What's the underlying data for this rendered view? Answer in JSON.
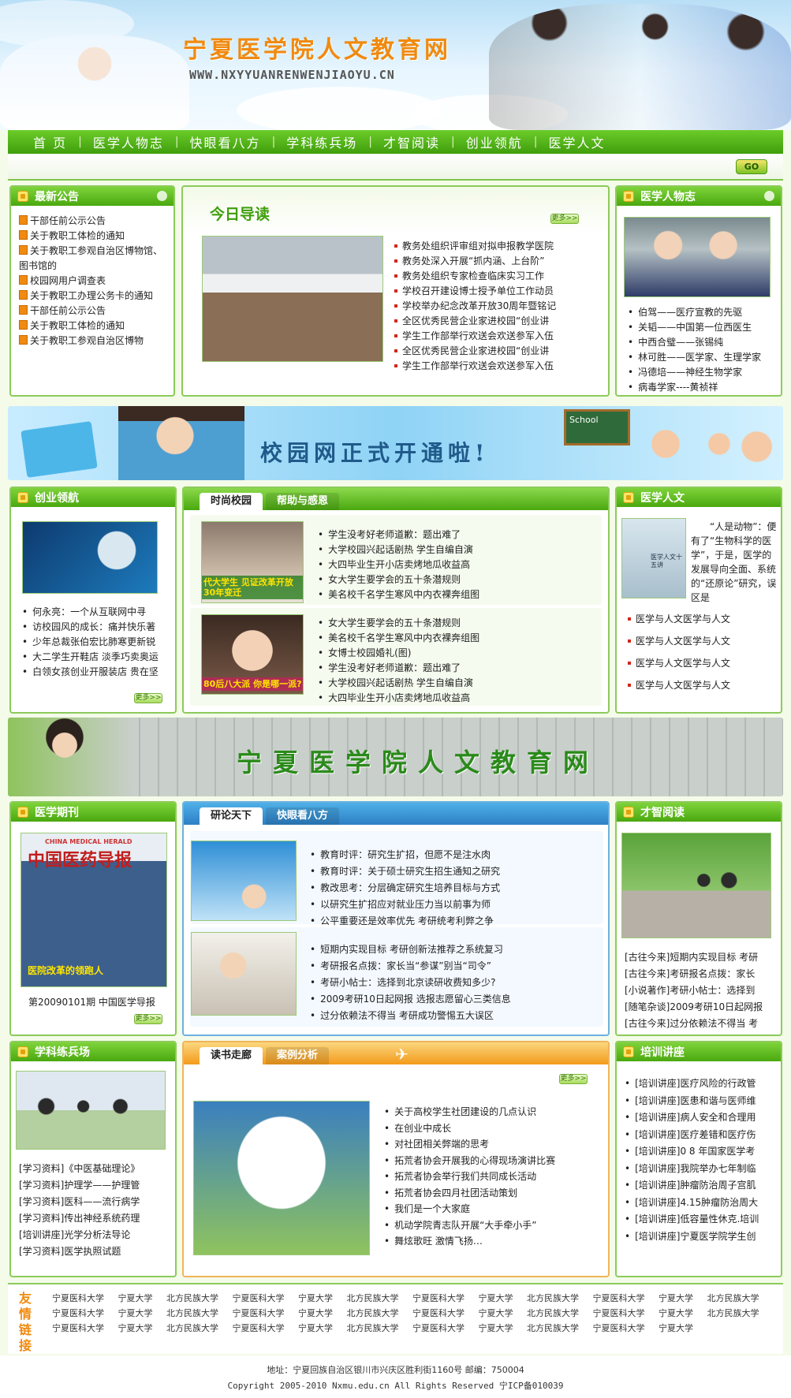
{
  "header": {
    "title": "宁夏医学院人文教育网",
    "url": "WWW.NXYYUANRENWENJIAOYU.CN"
  },
  "nav": [
    "首 页",
    "医学人物志",
    "快眼看八方",
    "学科练兵场",
    "才智阅读",
    "创业领航",
    "医学人文"
  ],
  "search": {
    "go_label": "GO"
  },
  "notice": {
    "title": "最新公告",
    "items": [
      "干部任前公示公告",
      "关于教职工体检的通知",
      "关于教职工参观自治区博物馆、图书馆的",
      "校园网用户调查表",
      "关于教职工办理公务卡的通知",
      "干部任前公示公告",
      "关于教职工体检的通知",
      "关于教职工参观自治区博物"
    ]
  },
  "today": {
    "title": "今日导读",
    "more": "更多>>",
    "items": [
      "教务处组织评审组对拟申报教学医院",
      "教务处深入开展“抓内涵、上台阶”",
      "教务处组织专家检查临床实习工作",
      "学校召开建设博士授予单位工作动员",
      "学校举办纪念改革开放30周年暨铭记",
      "全区优秀民营企业家进校园“创业讲",
      "学生工作部举行欢送会欢送参军入伍",
      "全区优秀民营企业家进校园“创业讲",
      "学生工作部举行欢送会欢送参军入伍"
    ]
  },
  "figures": {
    "title": "医学人物志",
    "items": [
      "伯驾——医疗宣教的先驱",
      "关韬——中国第一位西医生",
      "中西合璧——张锡纯",
      "林可胜——医学家、生理学家",
      "冯德培——神经生物学家",
      "病毒学家----黄祯祥"
    ]
  },
  "banner1": {
    "text": "校园网正式开通啦!",
    "school": "School"
  },
  "startup": {
    "title": "创业领航",
    "more": "更多>>",
    "items": [
      "何永亮：一个从互联网中寻",
      "访校园风的成长：痛并快乐著",
      "少年总裁张伯宏比肺寒更新锐",
      "大二学生开鞋店 淡季巧卖奥运",
      "白领女孩创业开服装店 贵在坚"
    ]
  },
  "campus": {
    "tabs": [
      "时尚校园",
      "帮助与感恩"
    ],
    "img1_text": "代大学生 见证改革开放30年变迁",
    "img2_text": "80后八大派 你是哪一派?",
    "list1": [
      "学生没考好老师道歉：题出难了",
      "大学校园兴起话剧热 学生自编自演",
      "大四毕业生开小店卖烤地瓜收益高",
      "女大学生要学会的五十条潜规则",
      "美名校千名学生寒风中内衣裸奔组图"
    ],
    "list2": [
      "女大学生要学会的五十条潜规则",
      "美名校千名学生寒风中内衣裸奔组图",
      "女博士校园婚礼(图)",
      "学生没考好老师道歉：题出难了",
      "大学校园兴起话剧热 学生自编自演",
      "大四毕业生开小店卖烤地瓜收益高"
    ]
  },
  "humanities": {
    "title": "医学人文",
    "book_title": "医学人文十五讲",
    "intro": "“人是动物”：便有了“生物科学的医学”，于是，医学的发展导向全面、系统的“还原论”研究，误区是",
    "items": [
      "医学与人文医学与人文",
      "医学与人文医学与人文",
      "医学与人文医学与人文",
      "医学与人文医学与人文"
    ]
  },
  "banner2": {
    "text": "宁夏医学院人文教育网"
  },
  "journal": {
    "title": "医学期刊",
    "cover_title": "中国医药导报",
    "cover_en": "CHINA MEDICAL HERALD",
    "cover_caption": "医院改革的领跑人",
    "issue": "第20090101期 中国医学导报",
    "more": "更多>>"
  },
  "discuss": {
    "tabs": [
      "研论天下",
      "快眼看八方"
    ],
    "list1": [
      "教育时评：研究生扩招，但愿不是注水肉",
      "教育时评：关于硕士研究生招生通知之研究",
      "教改思考：分层确定研究生培养目标与方式",
      "以研究生扩招应对就业压力当以前事为师",
      "公平重要还是效率优先 考研统考利弊之争"
    ],
    "list2": [
      "短期内实现目标 考研创新法推荐之系统复习",
      "考研报名点拨：家长当“参谋”别当“司令”",
      "考研小帖士：选择到北京读研收费知多少?",
      "2009考研10日起网报 选报志愿留心三类信息",
      "过分依赖法不得当 考研成功警惕五大误区"
    ]
  },
  "reading": {
    "title": "才智阅读",
    "items": [
      "[古往今来]短期内实现目标 考研",
      "[古往今来]考研报名点拨：家长",
      "[小说著作]考研小帖士：选择到",
      "[随笔杂谈]2009考研10日起网报",
      "[古往今来]过分依赖法不得当 考"
    ]
  },
  "drill": {
    "title": "学科练兵场",
    "items": [
      "[学习资料]《中医基础理论》",
      "[学习资料]护理学——护理管",
      "[学习资料]医科——流行病学",
      "[学习资料]传出神经系统药理",
      "[培训讲座]光学分析法导论",
      "[学习资料]医学执照试题"
    ]
  },
  "books": {
    "tabs": [
      "读书走廊",
      "案例分析"
    ],
    "more": "更多>>",
    "items": [
      "关于高校学生社团建设的几点认识",
      "在创业中成长",
      "对社团相关弊端的思考",
      "拓荒者协会开展我的心得现场演讲比赛",
      "拓荒者协会举行我们共同成长活动",
      "拓荒者协会四月社团活动策划",
      "我们是一个大家庭",
      "机动学院青志队开展“大手牵小手”",
      "舞炫歌旺 激情飞扬…"
    ]
  },
  "training": {
    "title": "培训讲座",
    "items": [
      "[培训讲座]医疗风险的行政管",
      "[培训讲座]医患和谐与医师维",
      "[培训讲座]病人安全和合理用",
      "[培训讲座]医疗差错和医疗伤",
      "[培训讲座]0 8 年国家医学考",
      "[培训讲座]我院举办七年制临",
      "[培训讲座]肿瘤防治周子宫肌",
      "[培训讲座]4.15肿瘤防治周大",
      "[培训讲座]低容量性休克.培训",
      "[培训讲座]宁夏医学院学生创"
    ]
  },
  "friends": {
    "label": "友情链接",
    "links": [
      "宁夏医科大学",
      "宁夏大学",
      "北方民族大学",
      "宁夏医科大学",
      "宁夏大学",
      "北方民族大学",
      "宁夏医科大学",
      "宁夏大学",
      "北方民族大学",
      "宁夏医科大学",
      "宁夏大学",
      "北方民族大学",
      "宁夏医科大学",
      "宁夏大学",
      "北方民族大学",
      "宁夏医科大学",
      "宁夏大学",
      "北方民族大学",
      "宁夏医科大学",
      "宁夏大学",
      "北方民族大学",
      "宁夏医科大学",
      "宁夏大学",
      "北方民族大学",
      "宁夏医科大学",
      "宁夏大学",
      "北方民族大学",
      "宁夏医科大学",
      "宁夏大学",
      "北方民族大学",
      "宁夏医科大学",
      "宁夏大学",
      "北方民族大学",
      "宁夏医科大学",
      "宁夏大学"
    ]
  },
  "footer": {
    "address": "地址：宁夏回族自治区银川市兴庆区胜利街1160号 邮编：750004",
    "copyright": "Copyright 2005-2010 Nxmu.edu.cn All Rights Reserved 宁ICP备010039"
  }
}
